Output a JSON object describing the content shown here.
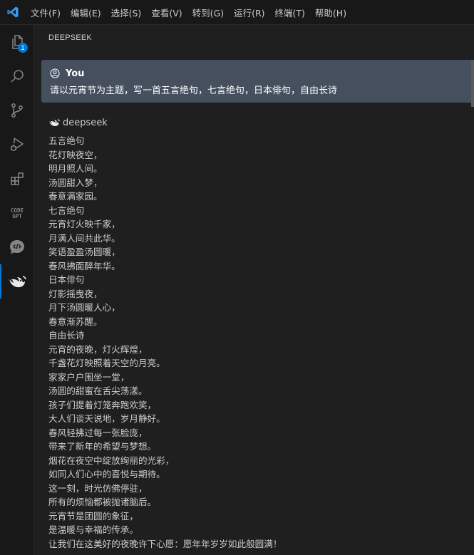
{
  "menu": [
    "文件(F)",
    "编辑(E)",
    "选择(S)",
    "查看(V)",
    "转到(G)",
    "运行(R)",
    "终端(T)",
    "帮助(H)"
  ],
  "activity": {
    "explorer_badge": "1",
    "items": [
      {
        "name": "explorer-icon"
      },
      {
        "name": "search-icon"
      },
      {
        "name": "source-control-icon"
      },
      {
        "name": "run-debug-icon"
      },
      {
        "name": "extensions-icon"
      },
      {
        "name": "codegpt-icon"
      },
      {
        "name": "chat-code-icon"
      },
      {
        "name": "deepseek-icon"
      }
    ]
  },
  "panel": {
    "title": "DEEPSEEK"
  },
  "chat": {
    "user": {
      "name": "You",
      "text": "请以元宵节为主题，写一首五言绝句，七言绝句，日本俳句，自由长诗"
    },
    "bot": {
      "name": "deepseek",
      "lines": [
        "五言绝句",
        "花灯映夜空，",
        "明月照人间。",
        "汤圆甜入梦，",
        "春意满家园。",
        "七言绝句",
        "元宵灯火映千家，",
        "月满人间共此华。",
        "笑语盈盈汤圆暖，",
        "春风拂面醉年华。",
        "日本俳句",
        "灯影摇曳夜，",
        "月下汤圆暖人心，",
        "春意渐苏醒。",
        "自由长诗",
        "元宵的夜晚，灯火辉煌，",
        "千盏花灯映照着天空的月亮。",
        "家家户户围坐一堂，",
        "汤圆的甜蜜在舌尖荡漾。",
        "孩子们提着灯笼奔跑欢笑，",
        "大人们谈天说地，岁月静好。",
        "春风轻拂过每一张脸庞，",
        "带来了新年的希望与梦想。",
        "烟花在夜空中绽放绚丽的光彩，",
        "如同人们心中的喜悦与期待。",
        "这一刻，时光仿佛停驻，",
        "所有的烦恼都被抛诸脑后。",
        "元宵节是团圆的象征，",
        "是温暖与幸福的传承。",
        "让我们在这美好的夜晚许下心愿：愿年年岁岁如此般圆满！"
      ]
    }
  },
  "colors": {
    "accent": "#0078d4",
    "user_bubble": "#454f5e",
    "background": "#1f1f1f",
    "logo": "#3a9df5"
  }
}
